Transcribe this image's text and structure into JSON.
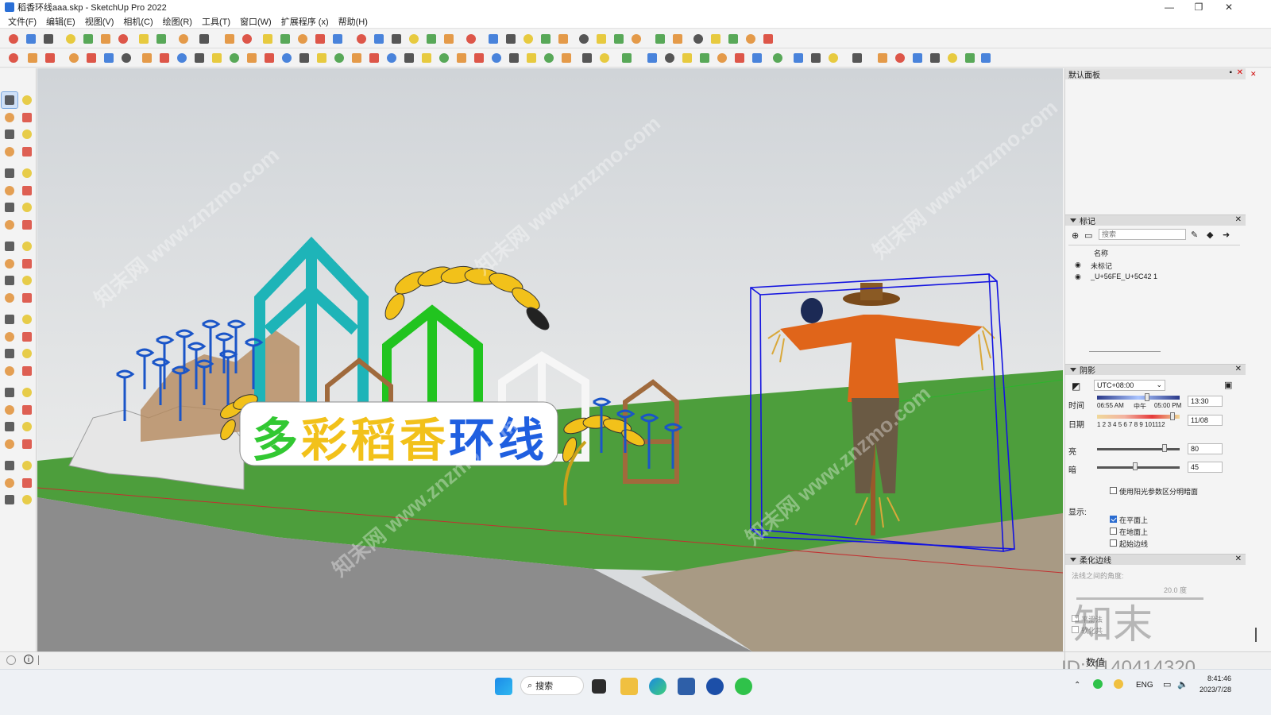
{
  "window": {
    "title": "稻香环线aaa.skp - SketchUp Pro 2022",
    "minimize_glyph": "—",
    "maximize_glyph": "❐",
    "close_glyph": "✕"
  },
  "menus": [
    "文件(F)",
    "编辑(E)",
    "视图(V)",
    "相机(C)",
    "绘图(R)",
    "工具(T)",
    "窗口(W)",
    "扩展程序 (x)",
    "帮助(H)"
  ],
  "toolbar_colors": {
    "accent": "#2b6cd0",
    "icon_dark": "#3a3a3a",
    "icon_red": "#d83a2a",
    "icon_orange": "#e08a2a",
    "icon_green": "#3c9a3c",
    "icon_blue": "#2a6fd6",
    "icon_yellow": "#e4c21e"
  },
  "tray": {
    "title": "默认面板",
    "pin_glyph": "📌",
    "close_glyph": "✕",
    "tags": {
      "section_title": "标记",
      "search_placeholder": "搜索",
      "column_name": "名称",
      "rows": [
        {
          "label": "未标记",
          "visible": true
        },
        {
          "label": "_U+56FE_U+5C42 1",
          "visible": true
        }
      ]
    },
    "shadows": {
      "section_title": "阴影",
      "timezone": "UTC+08:00",
      "time_label": "时间",
      "time_start": "06:55 AM",
      "time_mid": "中午",
      "time_end": "05:00 PM",
      "time_value": "13:30",
      "date_label": "日期",
      "months": "1 2 3 4 5 6 7 8 9 101112",
      "date_value": "11/08",
      "light_label": "亮",
      "light_value": "80",
      "dark_label": "暗",
      "dark_value": "45",
      "use_sun_label": "使用阳光参数区分明暗面",
      "use_sun_checked": false,
      "display_label": "显示:",
      "on_faces_label": "在平面上",
      "on_faces_checked": true,
      "on_ground_label": "在地面上",
      "on_ground_checked": false,
      "from_edges_label": "起始边线",
      "from_edges_checked": false
    },
    "soften": {
      "section_title": "柔化边线",
      "angle_label": "法线之间的角度:",
      "angle_value": "20.0 度",
      "smooth_label": "平滑法",
      "soften_label": "软化共"
    },
    "value_label": "数值"
  },
  "scene": {
    "sign_text": "多彩稻香环线",
    "sign_colors": [
      "#32c832",
      "#f2c11a",
      "#f2c11a",
      "#f2c11a",
      "#1f5fe0",
      "#1f5fe0"
    ],
    "watermark_text": "知末网 www.znzmo.com"
  },
  "overlay": {
    "logo_text": "知末",
    "id_text": "ID: 1140414320"
  },
  "taskbar": {
    "search_label": "搜索",
    "lang": "ENG",
    "time": "8:41:46",
    "date": "2023/7/28"
  }
}
